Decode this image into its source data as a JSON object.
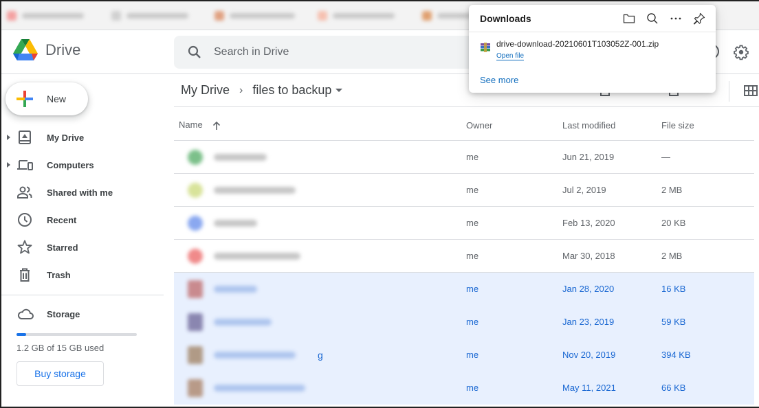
{
  "browser": {
    "tabs_blurred": true
  },
  "header": {
    "app_name": "Drive",
    "search_placeholder": "Search in Drive"
  },
  "sidebar": {
    "new_label": "New",
    "items": [
      {
        "label": "My Drive",
        "icon": "my-drive-icon",
        "expandable": true
      },
      {
        "label": "Computers",
        "icon": "computers-icon",
        "expandable": true
      },
      {
        "label": "Shared with me",
        "icon": "shared-icon",
        "expandable": false
      },
      {
        "label": "Recent",
        "icon": "clock-icon",
        "expandable": false
      },
      {
        "label": "Starred",
        "icon": "star-icon",
        "expandable": false
      },
      {
        "label": "Trash",
        "icon": "trash-icon",
        "expandable": false
      }
    ],
    "storage": {
      "label": "Storage",
      "used_text": "1.2 GB of 15 GB used",
      "used_fraction": 0.08,
      "buy_label": "Buy storage"
    }
  },
  "breadcrumb": {
    "root": "My Drive",
    "separator": "›",
    "current": "files to backup"
  },
  "table": {
    "columns": {
      "name": "Name",
      "owner": "Owner",
      "modified": "Last modified",
      "size": "File size"
    },
    "sort": "name-ascending",
    "rows": [
      {
        "name_redacted": true,
        "icon_color": "#7cc08a",
        "owner": "me",
        "modified": "Jun 21, 2019",
        "size": "—",
        "selected": false,
        "name_width": 0.55
      },
      {
        "name_redacted": true,
        "icon_color": "#d8e39a",
        "owner": "me",
        "modified": "Jul 2, 2019",
        "size": "2 MB",
        "selected": false,
        "name_width": 0.85
      },
      {
        "name_redacted": true,
        "icon_color": "#8aa8f0",
        "owner": "me",
        "modified": "Feb 13, 2020",
        "size": "20 KB",
        "selected": false,
        "name_width": 0.45
      },
      {
        "name_redacted": true,
        "icon_color": "#f08a8a",
        "owner": "me",
        "modified": "Mar 30, 2018",
        "size": "2 MB",
        "selected": false,
        "name_width": 0.9
      },
      {
        "name_redacted": true,
        "icon_color": "#c98a8e",
        "owner": "me",
        "modified": "Jan 28, 2020",
        "size": "16 KB",
        "selected": true,
        "name_width": 0.45
      },
      {
        "name_redacted": true,
        "icon_color": "#8a86b0",
        "owner": "me",
        "modified": "Jan 23, 2019",
        "size": "59 KB",
        "selected": true,
        "name_width": 0.6
      },
      {
        "name_redacted": true,
        "icon_color": "#b09a86",
        "owner": "me",
        "modified": "Nov 20, 2019",
        "size": "394 KB",
        "selected": true,
        "name_width": 0.85,
        "visible_tail": "g"
      },
      {
        "name_redacted": true,
        "icon_color": "#b89a88",
        "owner": "me",
        "modified": "May 11, 2021",
        "size": "66 KB",
        "selected": true,
        "name_width": 0.95
      }
    ]
  },
  "downloads": {
    "title": "Downloads",
    "actions": [
      "open-folder",
      "search",
      "more",
      "pin"
    ],
    "item": {
      "filename": "drive-download-20210601T103052Z-001.zip",
      "action": "Open file"
    },
    "see_more": "See more"
  },
  "colors": {
    "accent": "#1a73e8",
    "selected_row_bg": "#e8f0fe",
    "selected_text": "#1967d2",
    "link_edge": "#0f6cbd"
  }
}
